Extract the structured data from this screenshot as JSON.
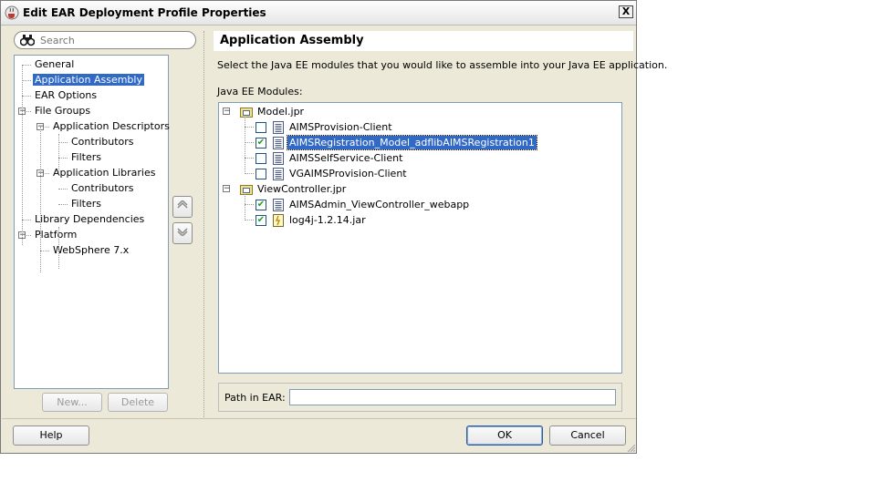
{
  "window": {
    "title": "Edit EAR Deployment Profile Properties",
    "close_glyph": "X"
  },
  "search": {
    "placeholder": "Search"
  },
  "nav": {
    "items": [
      {
        "label": "General"
      },
      {
        "label": "Application Assembly",
        "selected": true
      },
      {
        "label": "EAR Options"
      },
      {
        "label": "File Groups",
        "expander": "−"
      },
      {
        "label": "Application Descriptors",
        "expander": "−"
      },
      {
        "label": "Contributors"
      },
      {
        "label": "Filters"
      },
      {
        "label": "Application Libraries",
        "expander": "−"
      },
      {
        "label": "Contributors"
      },
      {
        "label": "Filters"
      },
      {
        "label": "Library Dependencies"
      },
      {
        "label": "Platform",
        "expander": "−"
      },
      {
        "label": "WebSphere 7.x"
      }
    ],
    "new_label": "New...",
    "delete_label": "Delete"
  },
  "main": {
    "title": "Application Assembly",
    "instruction": "Select the Java EE modules that you would like to assemble into your Java EE application.",
    "modules_label": "Java EE Modules:",
    "modules": [
      {
        "project": "Model.jpr",
        "expander": "−",
        "children": [
          {
            "label": "AIMSProvision-Client",
            "checked": false,
            "selected": false
          },
          {
            "label": "AIMSRegistration_Model_adflibAIMSRegistration1",
            "checked": true,
            "selected": true
          },
          {
            "label": "AIMSSelfService-Client",
            "checked": false,
            "selected": false
          },
          {
            "label": "VGAIMSProvision-Client",
            "checked": false,
            "selected": false
          }
        ]
      },
      {
        "project": "ViewController.jpr",
        "expander": "−",
        "children": [
          {
            "label": "AIMSAdmin_ViewController_webapp",
            "checked": true,
            "selected": false
          },
          {
            "label": "log4j-1.2.14.jar",
            "checked": true,
            "selected": false,
            "icon": "jar-icon"
          }
        ]
      }
    ],
    "path_label": "Path in EAR:",
    "path_value": ""
  },
  "footer": {
    "help_label": "Help",
    "ok_label": "OK",
    "cancel_label": "Cancel"
  },
  "colors": {
    "selection": "#3169c6",
    "dialog_bg": "#ece9d8",
    "check": "#21a121"
  }
}
